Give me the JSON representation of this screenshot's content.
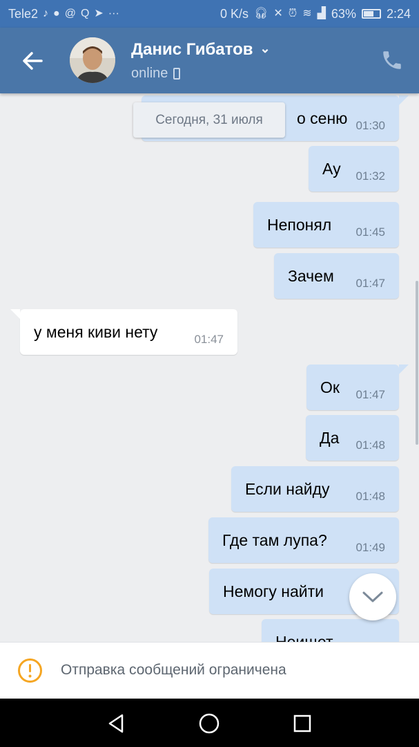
{
  "status_bar": {
    "carrier": "Tele2",
    "net_speed": "0 K/s",
    "battery": "63%",
    "time": "2:24"
  },
  "header": {
    "contact_name": "Данис Гибатов",
    "status": "online",
    "icons": [
      "back-arrow-icon",
      "chevron-down-icon",
      "mobile-device-icon",
      "phone-call-icon"
    ]
  },
  "chat": {
    "date_chip": "Сегодня, 31 июля",
    "messages": [
      {
        "direction": "out",
        "text": "о сеню",
        "time": "01:30"
      },
      {
        "direction": "out",
        "text": "Ау",
        "time": "01:32"
      },
      {
        "direction": "out",
        "text": "Непонял",
        "time": "01:45"
      },
      {
        "direction": "out",
        "text": "Зачем",
        "time": "01:47"
      },
      {
        "direction": "in",
        "text": "у меня киви нету",
        "time": "01:47"
      },
      {
        "direction": "out",
        "text": "Ок",
        "time": "01:47"
      },
      {
        "direction": "out",
        "text": "Да",
        "time": "01:48"
      },
      {
        "direction": "out",
        "text": "Если найду",
        "time": "01:48"
      },
      {
        "direction": "out",
        "text": "Где там лупа?",
        "time": "01:49"
      },
      {
        "direction": "out",
        "text": "Немогу найти",
        "time": ""
      },
      {
        "direction": "out",
        "text": "Неищет",
        "time": ""
      }
    ]
  },
  "restriction": {
    "text": "Отправка сообщений ограничена",
    "accent_color": "#f5a623"
  },
  "nav_bar": {
    "buttons": [
      "back-triangle-icon",
      "home-circle-icon",
      "recents-square-icon"
    ]
  },
  "colors": {
    "header_bg": "#4a76a8",
    "outgoing_bubble": "#cfe1f6",
    "incoming_bubble": "#ffffff",
    "chat_bg": "#edeef0"
  }
}
